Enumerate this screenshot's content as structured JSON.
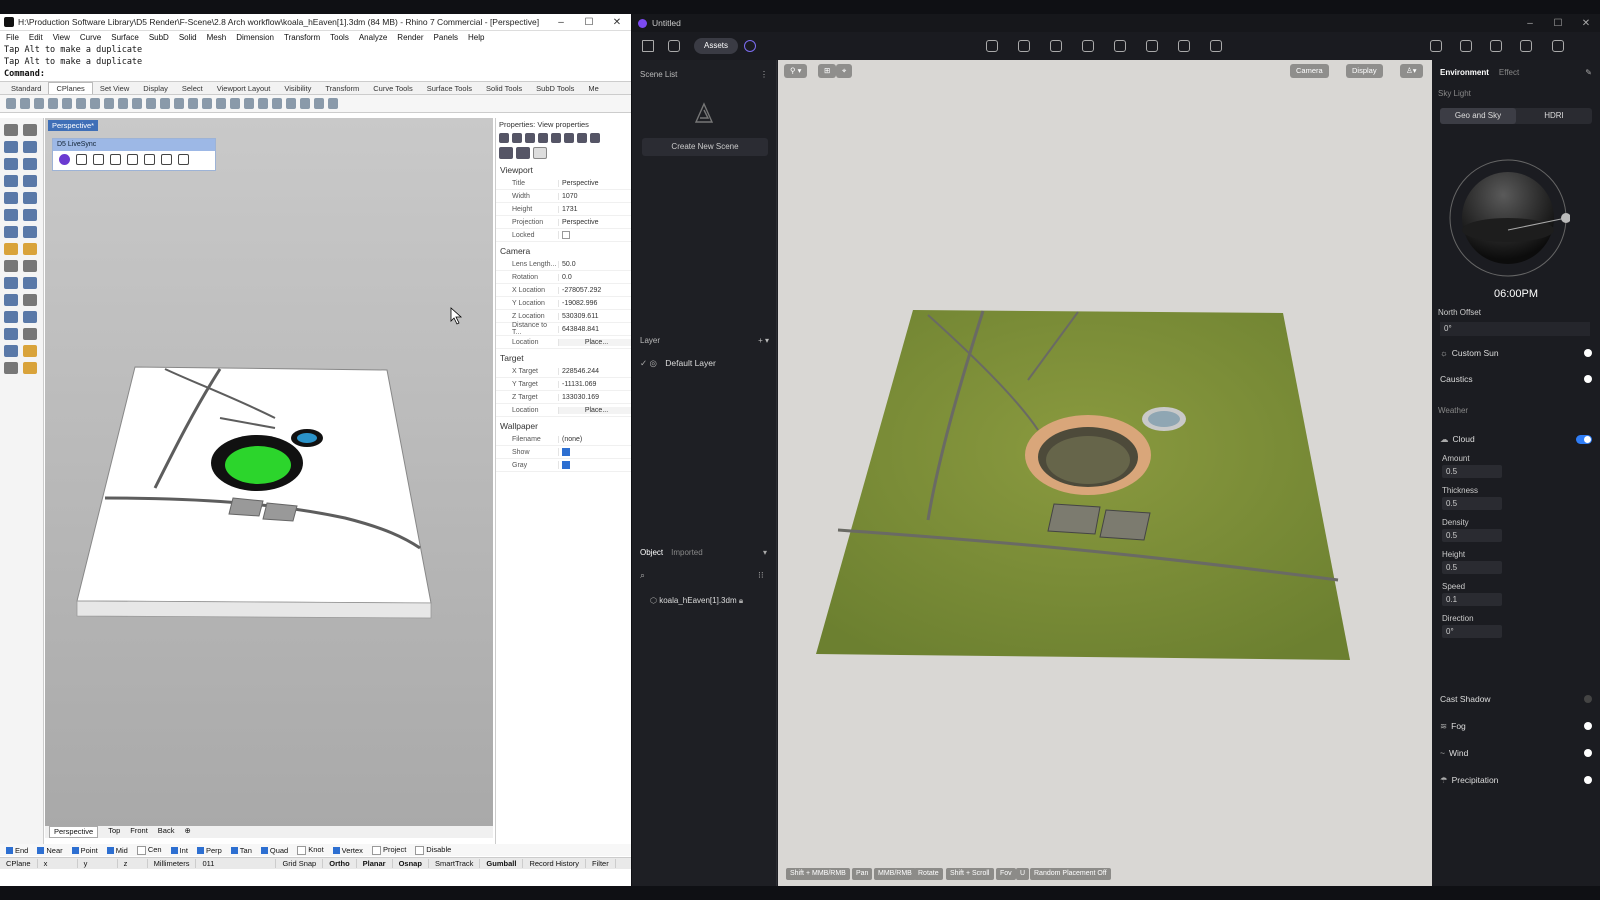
{
  "rhino": {
    "title": "H:\\Production Software Library\\D5 Render\\F-Scene\\2.8 Arch workflow\\koala_hEaven[1].3dm (84 MB) - Rhino 7 Commercial - [Perspective]",
    "menu": [
      "File",
      "Edit",
      "View",
      "Curve",
      "Surface",
      "SubD",
      "Solid",
      "Mesh",
      "Dimension",
      "Transform",
      "Tools",
      "Analyze",
      "Render",
      "Panels",
      "Help"
    ],
    "cmd_lines": [
      "Tap Alt to make a duplicate",
      "Tap Alt to make a duplicate"
    ],
    "cmd_prompt": "Command:",
    "tabs": [
      "Standard",
      "CPlanes",
      "Set View",
      "Display",
      "Select",
      "Viewport Layout",
      "Visibility",
      "Transform",
      "Curve Tools",
      "Surface Tools",
      "Solid Tools",
      "SubD Tools",
      "Me"
    ],
    "active_tab": "CPlanes",
    "viewport_label": "Perspective*",
    "d5_livesync": "D5 LiveSync",
    "viewport_tabs": [
      "Perspective",
      "Top",
      "Front",
      "Back"
    ],
    "properties": {
      "header": "Properties: View properties",
      "viewport_section": "Viewport",
      "title_k": "Title",
      "title_v": "Perspective",
      "width_k": "Width",
      "width_v": "1070",
      "height_k": "Height",
      "height_v": "1731",
      "projection_k": "Projection",
      "projection_v": "Perspective",
      "locked_k": "Locked",
      "camera_section": "Camera",
      "lens_k": "Lens Length...",
      "lens_v": "50.0",
      "rotation_k": "Rotation",
      "rotation_v": "0.0",
      "xloc_k": "X Location",
      "xloc_v": "-278057.292",
      "yloc_k": "Y Location",
      "yloc_v": "-19082.996",
      "zloc_k": "Z Location",
      "zloc_v": "530309.611",
      "dist_k": "Distance to T...",
      "dist_v": "643848.841",
      "loc_k": "Location",
      "loc_v": "Place...",
      "target_section": "Target",
      "xt_k": "X Target",
      "xt_v": "228546.244",
      "yt_k": "Y Target",
      "yt_v": "-11131.069",
      "zt_k": "Z Target",
      "zt_v": "133030.169",
      "tloc_k": "Location",
      "tloc_v": "Place...",
      "wallpaper_section": "Wallpaper",
      "filename_k": "Filename",
      "filename_v": "(none)",
      "show_k": "Show",
      "gray_k": "Gray"
    },
    "osnaps": [
      {
        "label": "End",
        "on": true
      },
      {
        "label": "Near",
        "on": true
      },
      {
        "label": "Point",
        "on": true
      },
      {
        "label": "Mid",
        "on": true
      },
      {
        "label": "Cen",
        "on": false
      },
      {
        "label": "Int",
        "on": true
      },
      {
        "label": "Perp",
        "on": true
      },
      {
        "label": "Tan",
        "on": true
      },
      {
        "label": "Quad",
        "on": true
      },
      {
        "label": "Knot",
        "on": false
      },
      {
        "label": "Vertex",
        "on": true
      },
      {
        "label": "Project",
        "on": false
      },
      {
        "label": "Disable",
        "on": false
      }
    ],
    "status": [
      "CPlane",
      "x",
      "y",
      "z",
      "Millimeters",
      "011",
      "Grid Snap",
      "Ortho",
      "Planar",
      "Osnap",
      "SmartTrack",
      "Gumball",
      "Record History",
      "Filter"
    ]
  },
  "d5": {
    "title": "Untitled",
    "assets_label": "Assets",
    "scene_list": "Scene List",
    "create_scene": "Create New Scene",
    "layer_header": "Layer",
    "default_layer": "Default Layer",
    "object_tab": "Object",
    "imported_tab": "Imported",
    "object_item": "koala_hEaven[1].3dm",
    "vp_camera": "Camera",
    "vp_display": "Display",
    "hints": [
      "Shift + MMB/RMB",
      "Pan",
      "MMB/RMB",
      "Rotate",
      "Shift + Scroll",
      "Fov",
      "U",
      "Random Placement Off"
    ],
    "right": {
      "tab_env": "Environment",
      "tab_effect": "Effect",
      "sky_light": "Sky Light",
      "geo_sky": "Geo and Sky",
      "hdri": "HDRI",
      "time": "06:00PM",
      "north_offset": "North Offset",
      "north_value": "0°",
      "custom_sun": "Custom Sun",
      "caustics": "Caustics",
      "weather": "Weather",
      "cloud": "Cloud",
      "amount": "Amount",
      "amount_v": "0.5",
      "thickness": "Thickness",
      "thickness_v": "0.5",
      "density": "Density",
      "density_v": "0.5",
      "height": "Height",
      "height_v": "0.5",
      "speed": "Speed",
      "speed_v": "0.1",
      "direction": "Direction",
      "direction_v": "0°",
      "cast_shadow": "Cast Shadow",
      "fog": "Fog",
      "wind": "Wind",
      "precipitation": "Precipitation"
    }
  }
}
